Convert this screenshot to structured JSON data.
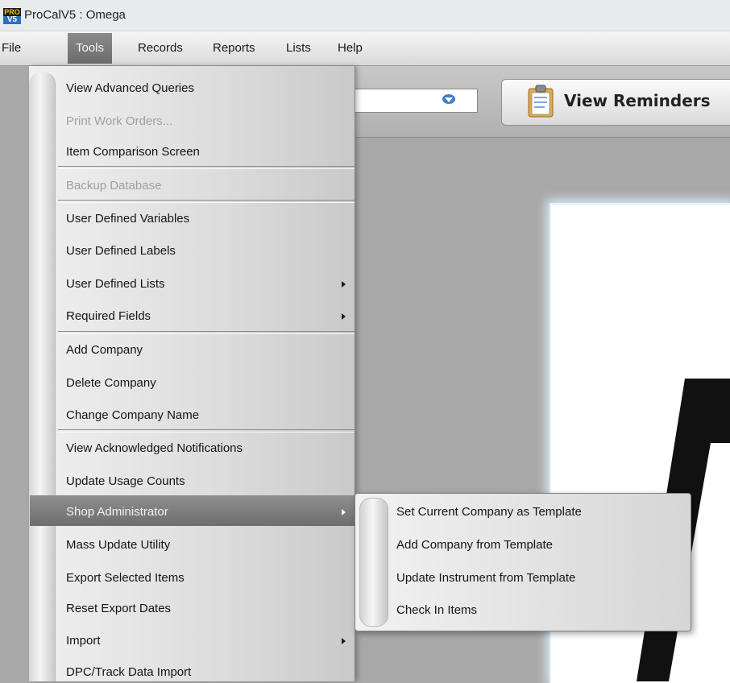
{
  "window": {
    "logo_top": "PRO",
    "logo_bottom": "V5",
    "title": "ProCalV5 : Omega"
  },
  "menubar": {
    "items": [
      "File",
      "Tools",
      "Records",
      "Reports",
      "Lists",
      "Help"
    ],
    "active": "Tools"
  },
  "toolbar": {
    "combo_value": "",
    "combo_icon": "dropdown-arrow-icon",
    "view_reminders_label": "View Reminders",
    "view_reminders_icon": "clipboard-icon"
  },
  "tools_menu": {
    "items": [
      {
        "label": "View Advanced Queries",
        "enabled": true
      },
      {
        "label": "Print Work Orders...",
        "enabled": false
      },
      {
        "label": "Item Comparison Screen",
        "enabled": true
      },
      {
        "label": "Backup Database",
        "enabled": false
      },
      {
        "label": "User Defined Variables",
        "enabled": true
      },
      {
        "label": "User Defined Labels",
        "enabled": true
      },
      {
        "label": "User Defined Lists",
        "enabled": true,
        "submenu": true
      },
      {
        "label": "Required Fields",
        "enabled": true,
        "submenu": true
      },
      {
        "label": "Add Company",
        "enabled": true
      },
      {
        "label": "Delete Company",
        "enabled": true
      },
      {
        "label": "Change Company Name",
        "enabled": true
      },
      {
        "label": "View Acknowledged Notifications",
        "enabled": true
      },
      {
        "label": "Update Usage Counts",
        "enabled": true
      },
      {
        "label": "Shop Administrator",
        "enabled": true,
        "submenu": true,
        "highlighted": true
      },
      {
        "label": "Mass Update Utility",
        "enabled": true
      },
      {
        "label": "Export Selected Items",
        "enabled": true
      },
      {
        "label": "Reset Export Dates",
        "enabled": true
      },
      {
        "label": "Import",
        "enabled": true,
        "submenu": true
      },
      {
        "label": "DPC/Track Data Import",
        "enabled": true
      }
    ]
  },
  "shop_admin_submenu": {
    "items": [
      "Set Current Company as Template",
      "Add Company from Template",
      "Update Instrument from Template",
      "Check In Items"
    ]
  },
  "colors": {
    "highlight": "#7a7a7a",
    "disabled_text": "#a0a0a0",
    "content_glow": "#d9ecf7"
  }
}
